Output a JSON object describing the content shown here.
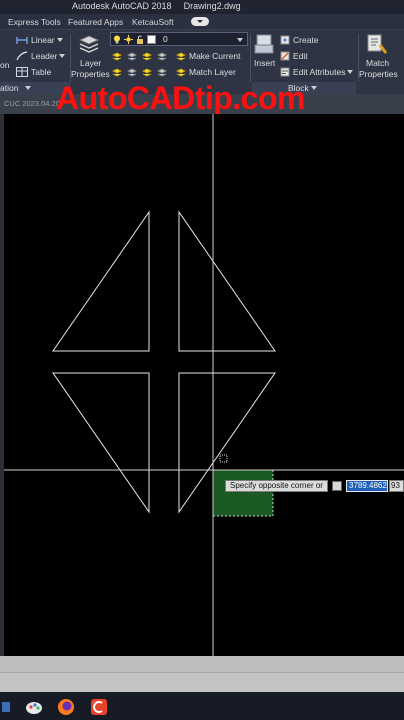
{
  "window": {
    "app_title": "Autodesk AutoCAD 2018",
    "file_name": "Drawing2.dwg"
  },
  "menu_tabs": [
    "Express Tools",
    "Featured Apps",
    "KetcauSoft"
  ],
  "ribbon": {
    "annotation": {
      "cut_label_top": "on",
      "linear_label": "Linear",
      "leader_label": "Leader",
      "table_label": "Table",
      "panel_label": "ation"
    },
    "layers": {
      "layer_properties_label_1": "Layer",
      "layer_properties_label_2": "Properties",
      "current_layer": "0",
      "make_current_label": "Make Current",
      "match_layer_label": "Match Layer"
    },
    "block": {
      "insert_label": "Insert",
      "create_label": "Create",
      "edit_label": "Edit",
      "edit_attributes_label": "Edit Attributes",
      "panel_label": "Block"
    },
    "properties": {
      "match_label_1": "Match",
      "match_label_2": "Properties"
    }
  },
  "doc_tab_text": "CUC 2023.04.20",
  "watermark": "AutoCADtip.com",
  "command": {
    "prompt": "Specify opposite corner or",
    "coord_x": "3789.4862",
    "coord_y_partial": "93"
  },
  "colors": {
    "selection_fill": "#1b5a22",
    "crosshair": "#cfcfcf",
    "watermark": "#ff1010",
    "input_highlight": "#1e5fb8"
  }
}
